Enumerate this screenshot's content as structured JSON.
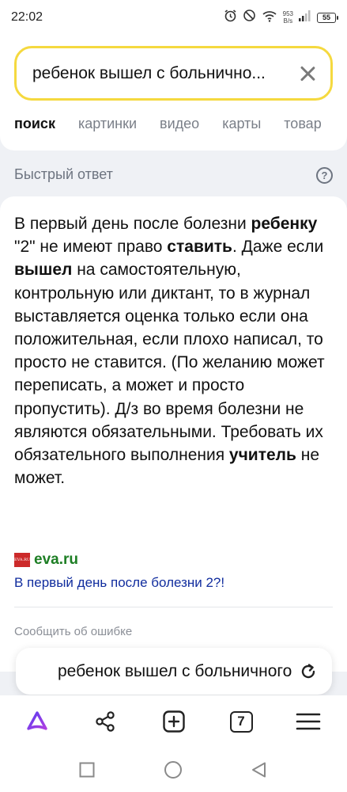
{
  "status_bar": {
    "time": "22:02",
    "speed_value": "953",
    "speed_unit": "B/s",
    "battery": "55",
    "icons": [
      "alarm-icon",
      "do-not-disturb-icon",
      "wifi-icon",
      "signal-icon",
      "battery-icon"
    ]
  },
  "search": {
    "query": "ребенок вышел с больнично...",
    "clear_icon": "close-icon"
  },
  "tabs": [
    {
      "label": "поиск",
      "active": true
    },
    {
      "label": "картинки",
      "active": false
    },
    {
      "label": "видео",
      "active": false
    },
    {
      "label": "карты",
      "active": false
    },
    {
      "label": "товар",
      "active": false
    }
  ],
  "quick_answer": {
    "label": "Быстрый ответ",
    "help_icon": "question-icon",
    "help_symbol": "?",
    "segments": [
      {
        "text": "В первый день после болезни ",
        "bold": false
      },
      {
        "text": "ребенку",
        "bold": true
      },
      {
        "text": " \"2\" не имеют право ",
        "bold": false
      },
      {
        "text": "ставить",
        "bold": true
      },
      {
        "text": ". Даже если ",
        "bold": false
      },
      {
        "text": "вышел",
        "bold": true
      },
      {
        "text": " на самостоятельную, контрольную или диктант, то в журнал выставляется оценка только если она положительная, если плохо написал, то просто не ставится. (По желанию может переписать, а может и просто пропустить). Д/з во время болезни не являются обязательными. Требовать их обязательного выполнения ",
        "bold": false
      },
      {
        "text": "учитель",
        "bold": true
      },
      {
        "text": " не может.",
        "bold": false
      }
    ],
    "source_logo_text": "EVA.RU",
    "source_name": "eva.ru",
    "source_link": "В первый день после болезни 2?!",
    "report": "Сообщить об ошибке"
  },
  "query_pill": {
    "text": "ребенок вышел с больничного",
    "refresh_icon": "refresh-icon"
  },
  "bottom_nav": {
    "tab_count": "7",
    "icons": [
      "alice-icon",
      "share-icon",
      "new-tab-icon",
      "tabs-icon",
      "menu-icon"
    ]
  },
  "colors": {
    "search_border": "#f5d93f",
    "source_green": "#1d7e24",
    "link_blue": "#112d9e",
    "alice_purple": "#7b3ff2"
  }
}
